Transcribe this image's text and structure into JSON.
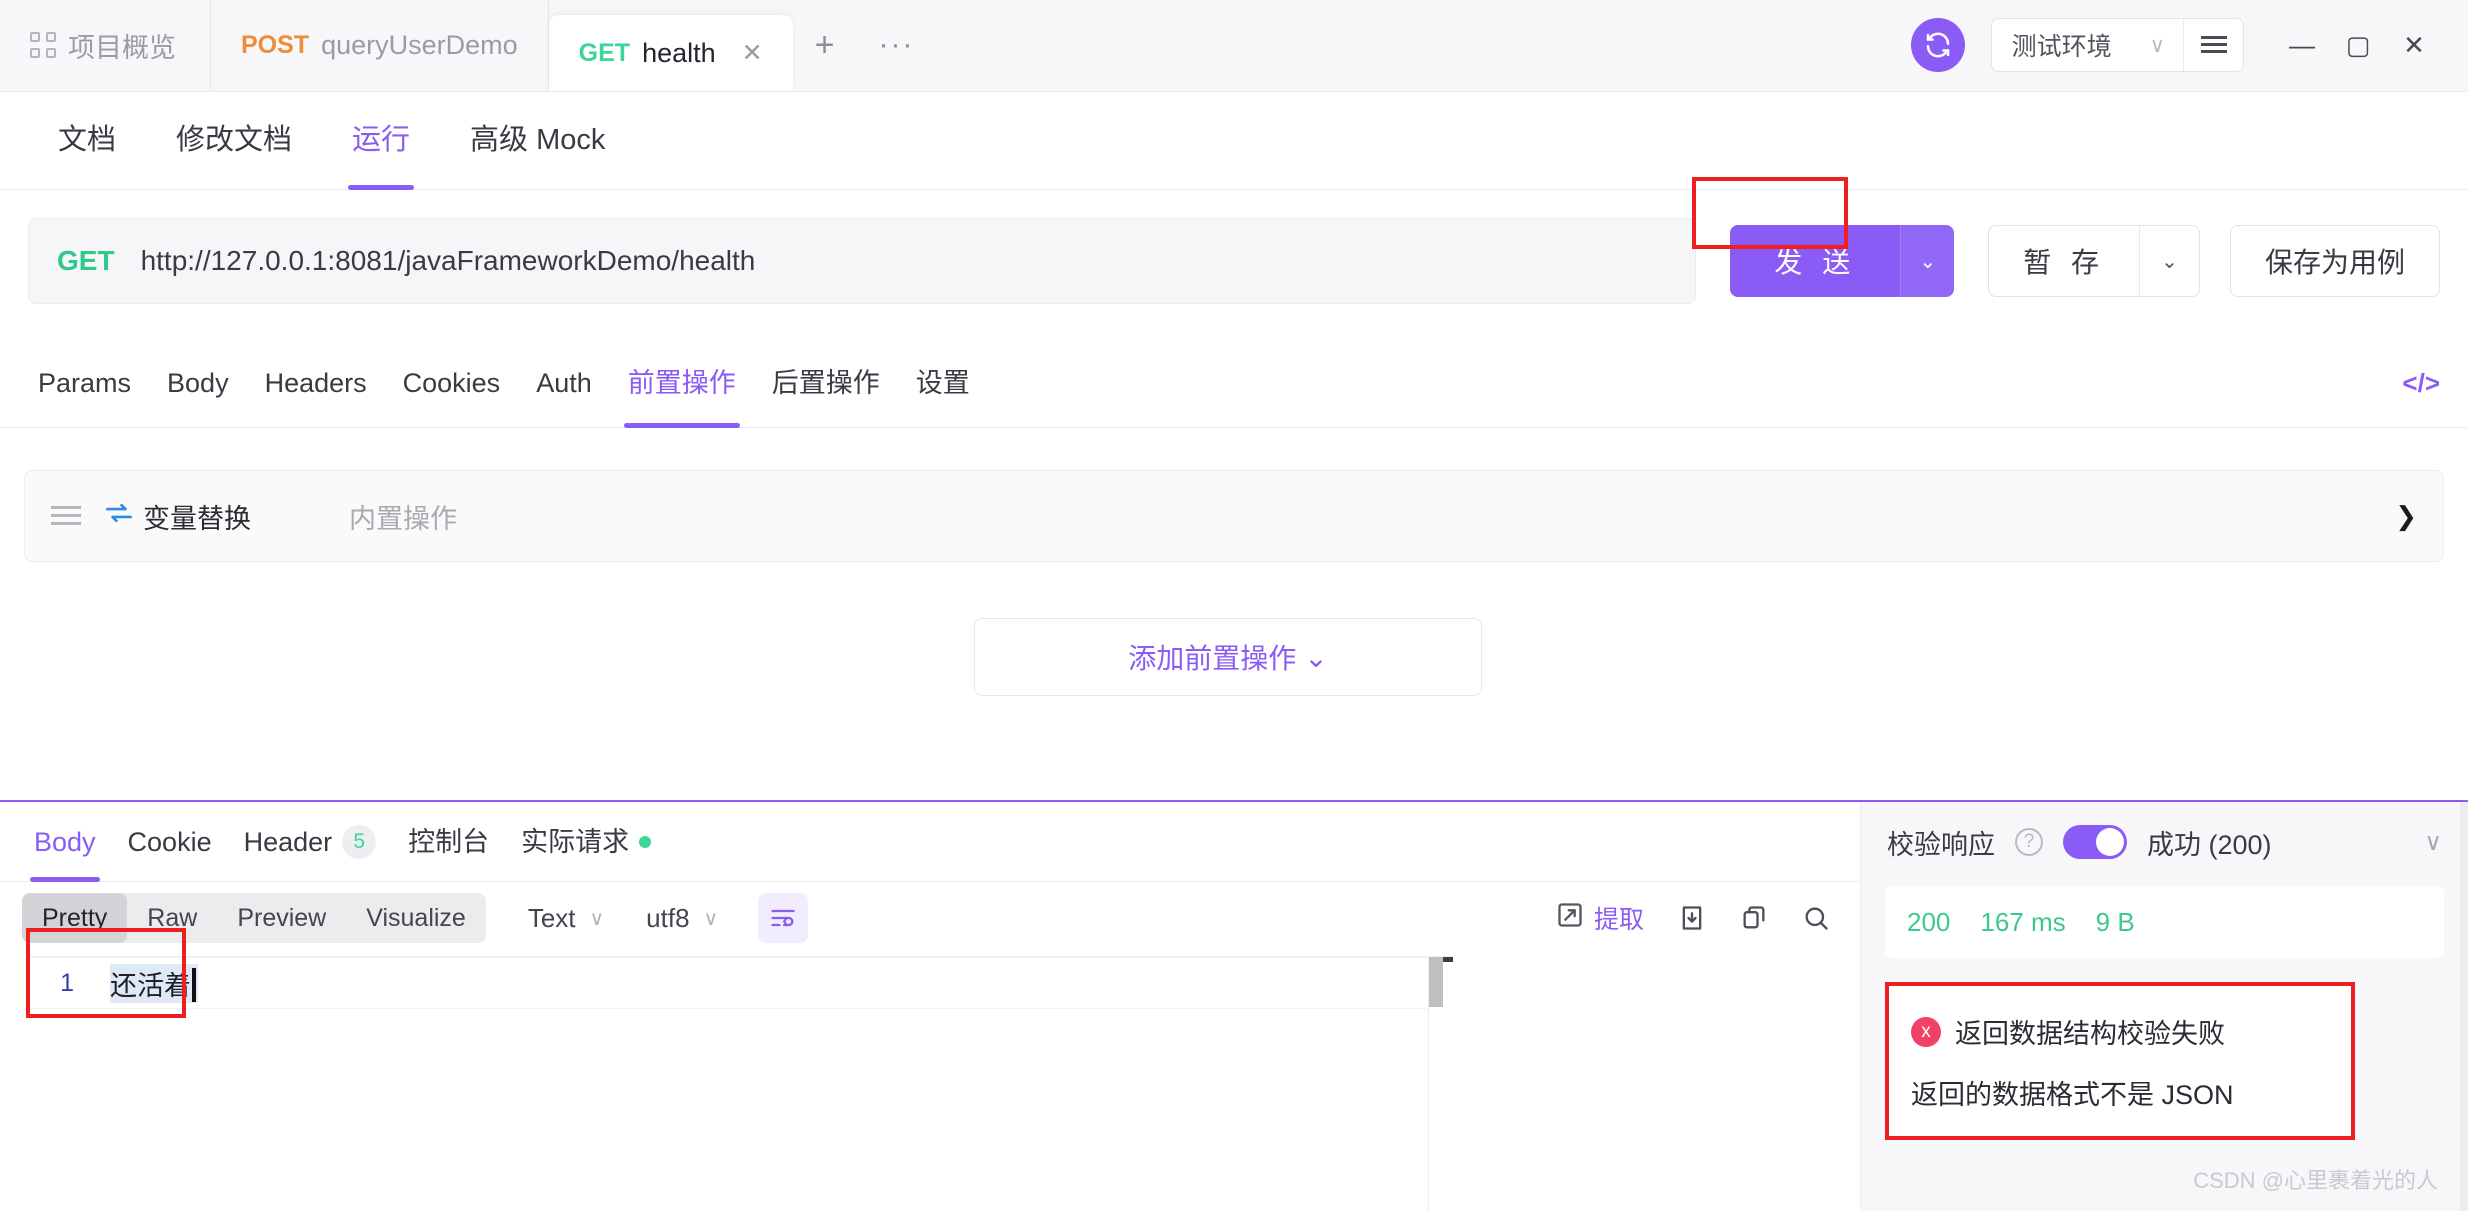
{
  "titlebar": {
    "project_tab": "项目概览",
    "tabs": [
      {
        "method": "POST",
        "name": "queryUserDemo"
      },
      {
        "method": "GET",
        "name": "health"
      }
    ],
    "close_label": "✕",
    "new_tab_label": "+",
    "more_label": "···",
    "sync_icon": "sync-icon",
    "environment": "测试环境",
    "env_chevron": "∨",
    "window_minimize": "—",
    "window_maximize": "▢",
    "window_close": "✕"
  },
  "docnav": {
    "items": [
      "文档",
      "修改文档",
      "运行",
      "高级 Mock"
    ],
    "active": "运行"
  },
  "url_bar": {
    "method": "GET",
    "url": "http://127.0.0.1:8081/javaFrameworkDemo/health",
    "send_label": "发 送",
    "send_chevron": "⌄",
    "temp_save_label": "暂 存",
    "temp_save_chevron": "⌄",
    "save_case_label": "保存为用例"
  },
  "param_tabs": {
    "items": [
      "Params",
      "Body",
      "Headers",
      "Cookies",
      "Auth",
      "前置操作",
      "后置操作",
      "设置"
    ],
    "active": "前置操作",
    "code_icon_label": "</>"
  },
  "preop_row": {
    "drag_handle": "drag-handle-icon",
    "swap_icon": "⇄",
    "name": "变量替换",
    "sub": "内置操作",
    "arrow": "❯"
  },
  "add_preop": {
    "label": "添加前置操作",
    "chevron": "⌄"
  },
  "response": {
    "tabs": [
      {
        "label": "Body"
      },
      {
        "label": "Cookie"
      },
      {
        "label": "Header",
        "badge": "5"
      },
      {
        "label": "控制台"
      },
      {
        "label": "实际请求",
        "dot": true
      }
    ],
    "active_tab": "Body",
    "format_segments": [
      "Pretty",
      "Raw",
      "Preview",
      "Visualize"
    ],
    "active_segment": "Pretty",
    "type_select": "Text",
    "type_chevron": "∨",
    "encoding_select": "utf8",
    "encoding_chevron": "∨",
    "wrap_icon": "wrap-lines-icon",
    "extract_label": "提取",
    "download_icon": "download-icon",
    "copy_icon": "copy-icon",
    "search_icon": "search-icon",
    "body_lines": [
      {
        "number": "1",
        "text": "还活着"
      }
    ]
  },
  "validation": {
    "title": "校验响应",
    "help_icon": "?",
    "toggle_on": true,
    "status_label": "成功 (200)",
    "collapse_chevron": "∨",
    "stats": {
      "status_code": "200",
      "time": "167 ms",
      "size": "9 B"
    },
    "error_icon": "x",
    "error_title": "返回数据结构校验失败",
    "error_detail": "返回的数据格式不是 JSON"
  },
  "watermark": "CSDN @心里裹着光的人",
  "colors": {
    "accent": "#8a5cf5",
    "get_green": "#3dd598",
    "post_orange": "#f08b38",
    "error_red": "#f04266",
    "annotation_red": "#f01f1f"
  }
}
